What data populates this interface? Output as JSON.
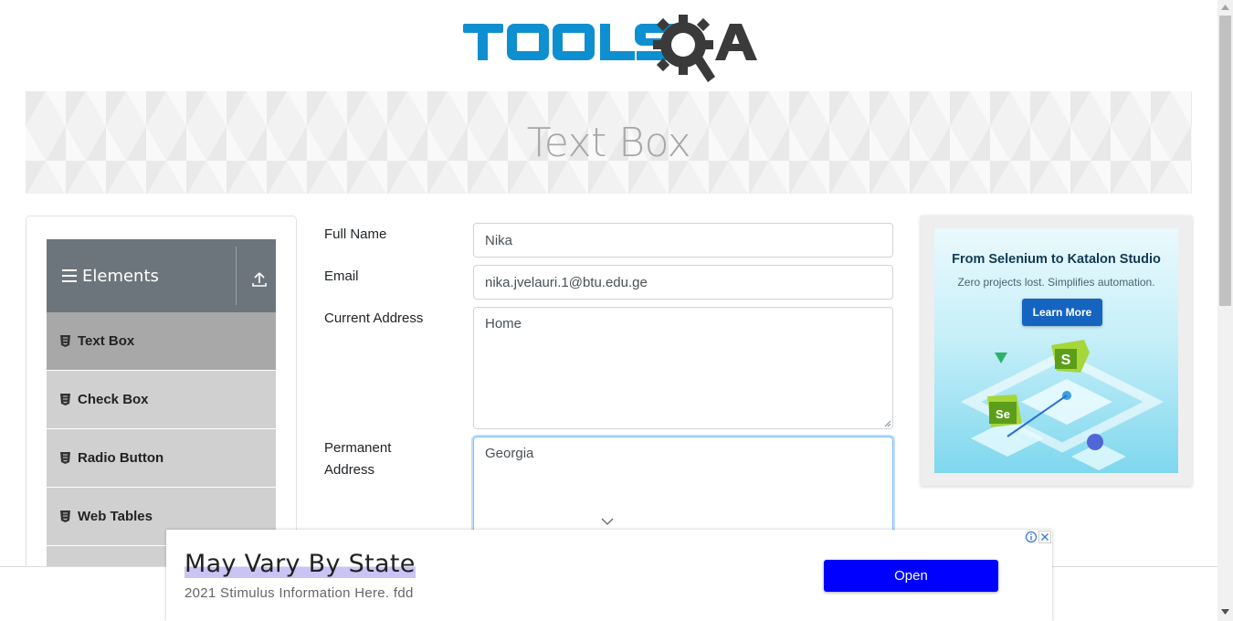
{
  "header": {
    "logo_text": "TOOLSQA"
  },
  "banner": {
    "title": "Text Box"
  },
  "sidebar": {
    "group_title": "Elements",
    "items": [
      {
        "label": "Text Box",
        "active": true
      },
      {
        "label": "Check Box",
        "active": false
      },
      {
        "label": "Radio Button",
        "active": false
      },
      {
        "label": "Web Tables",
        "active": false
      }
    ]
  },
  "form": {
    "full_name": {
      "label": "Full Name",
      "value": "Nika"
    },
    "email": {
      "label": "Email",
      "value": "nika.jvelauri.1@btu.edu.ge"
    },
    "current_address": {
      "label": "Current Address",
      "value": "Home"
    },
    "permanent_address": {
      "label_line1": "Permanent",
      "label_line2": "Address",
      "value": "Georgia"
    }
  },
  "side_ad": {
    "title": "From Selenium to Katalon Studio",
    "subtitle": "Zero projects lost. Simplifies automation.",
    "button": "Learn More"
  },
  "bottom_ad": {
    "headline": "May Vary By State",
    "description": "2021 Stimulus Information Here. fdd",
    "button": "Open"
  },
  "colors": {
    "logo_blue": "#0d8fd0",
    "logo_dark": "#3a3a3a",
    "sidebar_header": "#6d757c",
    "menu_item": "#d0d0d0",
    "menu_item_active": "#a8a8a8",
    "ad_button": "#0000ff"
  },
  "icons": [
    "hamburger-icon",
    "collapse-up-icon",
    "html5-icon",
    "info-icon",
    "close-icon",
    "chevron-down-icon"
  ]
}
